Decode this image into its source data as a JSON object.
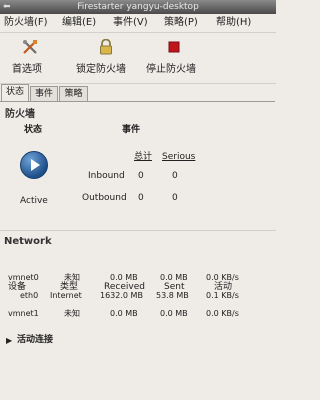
{
  "window": {
    "title": "Firestarter yangyu-desktop"
  },
  "menubar": {
    "items": [
      {
        "label": "防火墙(F)"
      },
      {
        "label": "编辑(E)"
      },
      {
        "label": "事件(V)"
      },
      {
        "label": "策略(P)"
      },
      {
        "label": "帮助(H)"
      }
    ]
  },
  "toolbar": {
    "preferences_label": "首选项",
    "lock_label": "锁定防火墙",
    "stop_label": "停止防火墙"
  },
  "tabs": [
    {
      "label": "状态"
    },
    {
      "label": "事件"
    },
    {
      "label": "策略"
    }
  ],
  "firewall": {
    "section_title": "防火墙",
    "status_header": "状态",
    "events_header": "事件",
    "status_text": "Active",
    "col_total": "总计",
    "col_serious": "Serious",
    "rows": [
      {
        "label": "Inbound",
        "total": "0",
        "serious": "0"
      },
      {
        "label": "Outbound",
        "total": "0",
        "serious": "0"
      }
    ]
  },
  "network": {
    "section_title": "Network",
    "headers": [
      "设备",
      "类型",
      "Received",
      "Sent",
      "活动"
    ],
    "rows": [
      {
        "device": "vmnet0",
        "type": "未知",
        "received": "0.0 MB",
        "sent": "0.0 MB",
        "activity": "0.0 KB/s"
      },
      {
        "device": "eth0",
        "type": "Internet",
        "received": "1632.0 MB",
        "sent": "53.8 MB",
        "activity": "0.1 KB/s"
      },
      {
        "device": "vmnet1",
        "type": "未知",
        "received": "0.0 MB",
        "sent": "0.0 MB",
        "activity": "0.0 KB/s"
      }
    ]
  },
  "active_connections": {
    "label": "活动连接"
  }
}
